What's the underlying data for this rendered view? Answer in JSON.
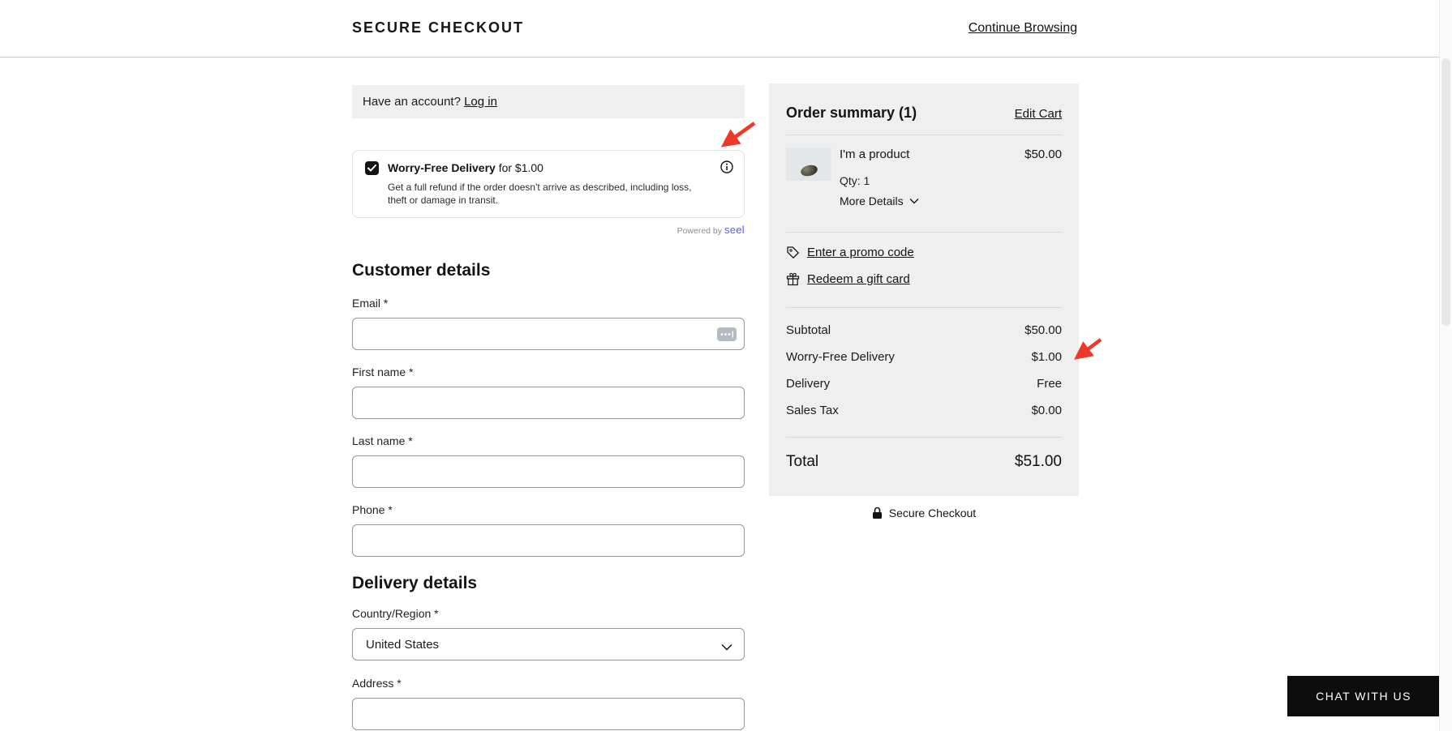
{
  "header": {
    "title": "SECURE CHECKOUT",
    "continue_browsing": "Continue Browsing"
  },
  "login_banner": {
    "text": "Have an account?",
    "link": "Log in"
  },
  "worry_free": {
    "title": "Worry-Free Delivery",
    "price_suffix": " for $1.00",
    "description": "Get a full refund if the order doesn't arrive as described, including loss, theft or damage in transit.",
    "powered_by": "Powered by ",
    "brand": "seel"
  },
  "customer_details": {
    "heading": "Customer details",
    "fields": [
      {
        "label": "Email *"
      },
      {
        "label": "First name *"
      },
      {
        "label": "Last name *"
      },
      {
        "label": "Phone *"
      }
    ]
  },
  "delivery_details": {
    "heading": "Delivery details",
    "country_label": "Country/Region *",
    "country_value": "United States",
    "address_label": "Address *"
  },
  "order_summary": {
    "title": "Order summary (1)",
    "edit_cart": "Edit Cart",
    "item": {
      "name": "I'm a product",
      "price": "$50.00",
      "qty": "Qty: 1",
      "more_details": "More Details"
    },
    "promo_link": "Enter a promo code",
    "gift_link": "Redeem a gift card",
    "totals": [
      {
        "label": "Subtotal",
        "value": "$50.00"
      },
      {
        "label": "Worry-Free Delivery",
        "value": "$1.00"
      },
      {
        "label": "Delivery",
        "value": "Free"
      },
      {
        "label": "Sales Tax",
        "value": "$0.00"
      }
    ],
    "total_label": "Total",
    "total_value": "$51.00",
    "secure_note": "Secure Checkout"
  },
  "chat_button": "CHAT WITH US",
  "colors": {
    "arrow_red": "#ee3829",
    "seel_purple": "#5b57ee",
    "panel_bg": "#efefef",
    "checkbox_black": "#141414"
  }
}
